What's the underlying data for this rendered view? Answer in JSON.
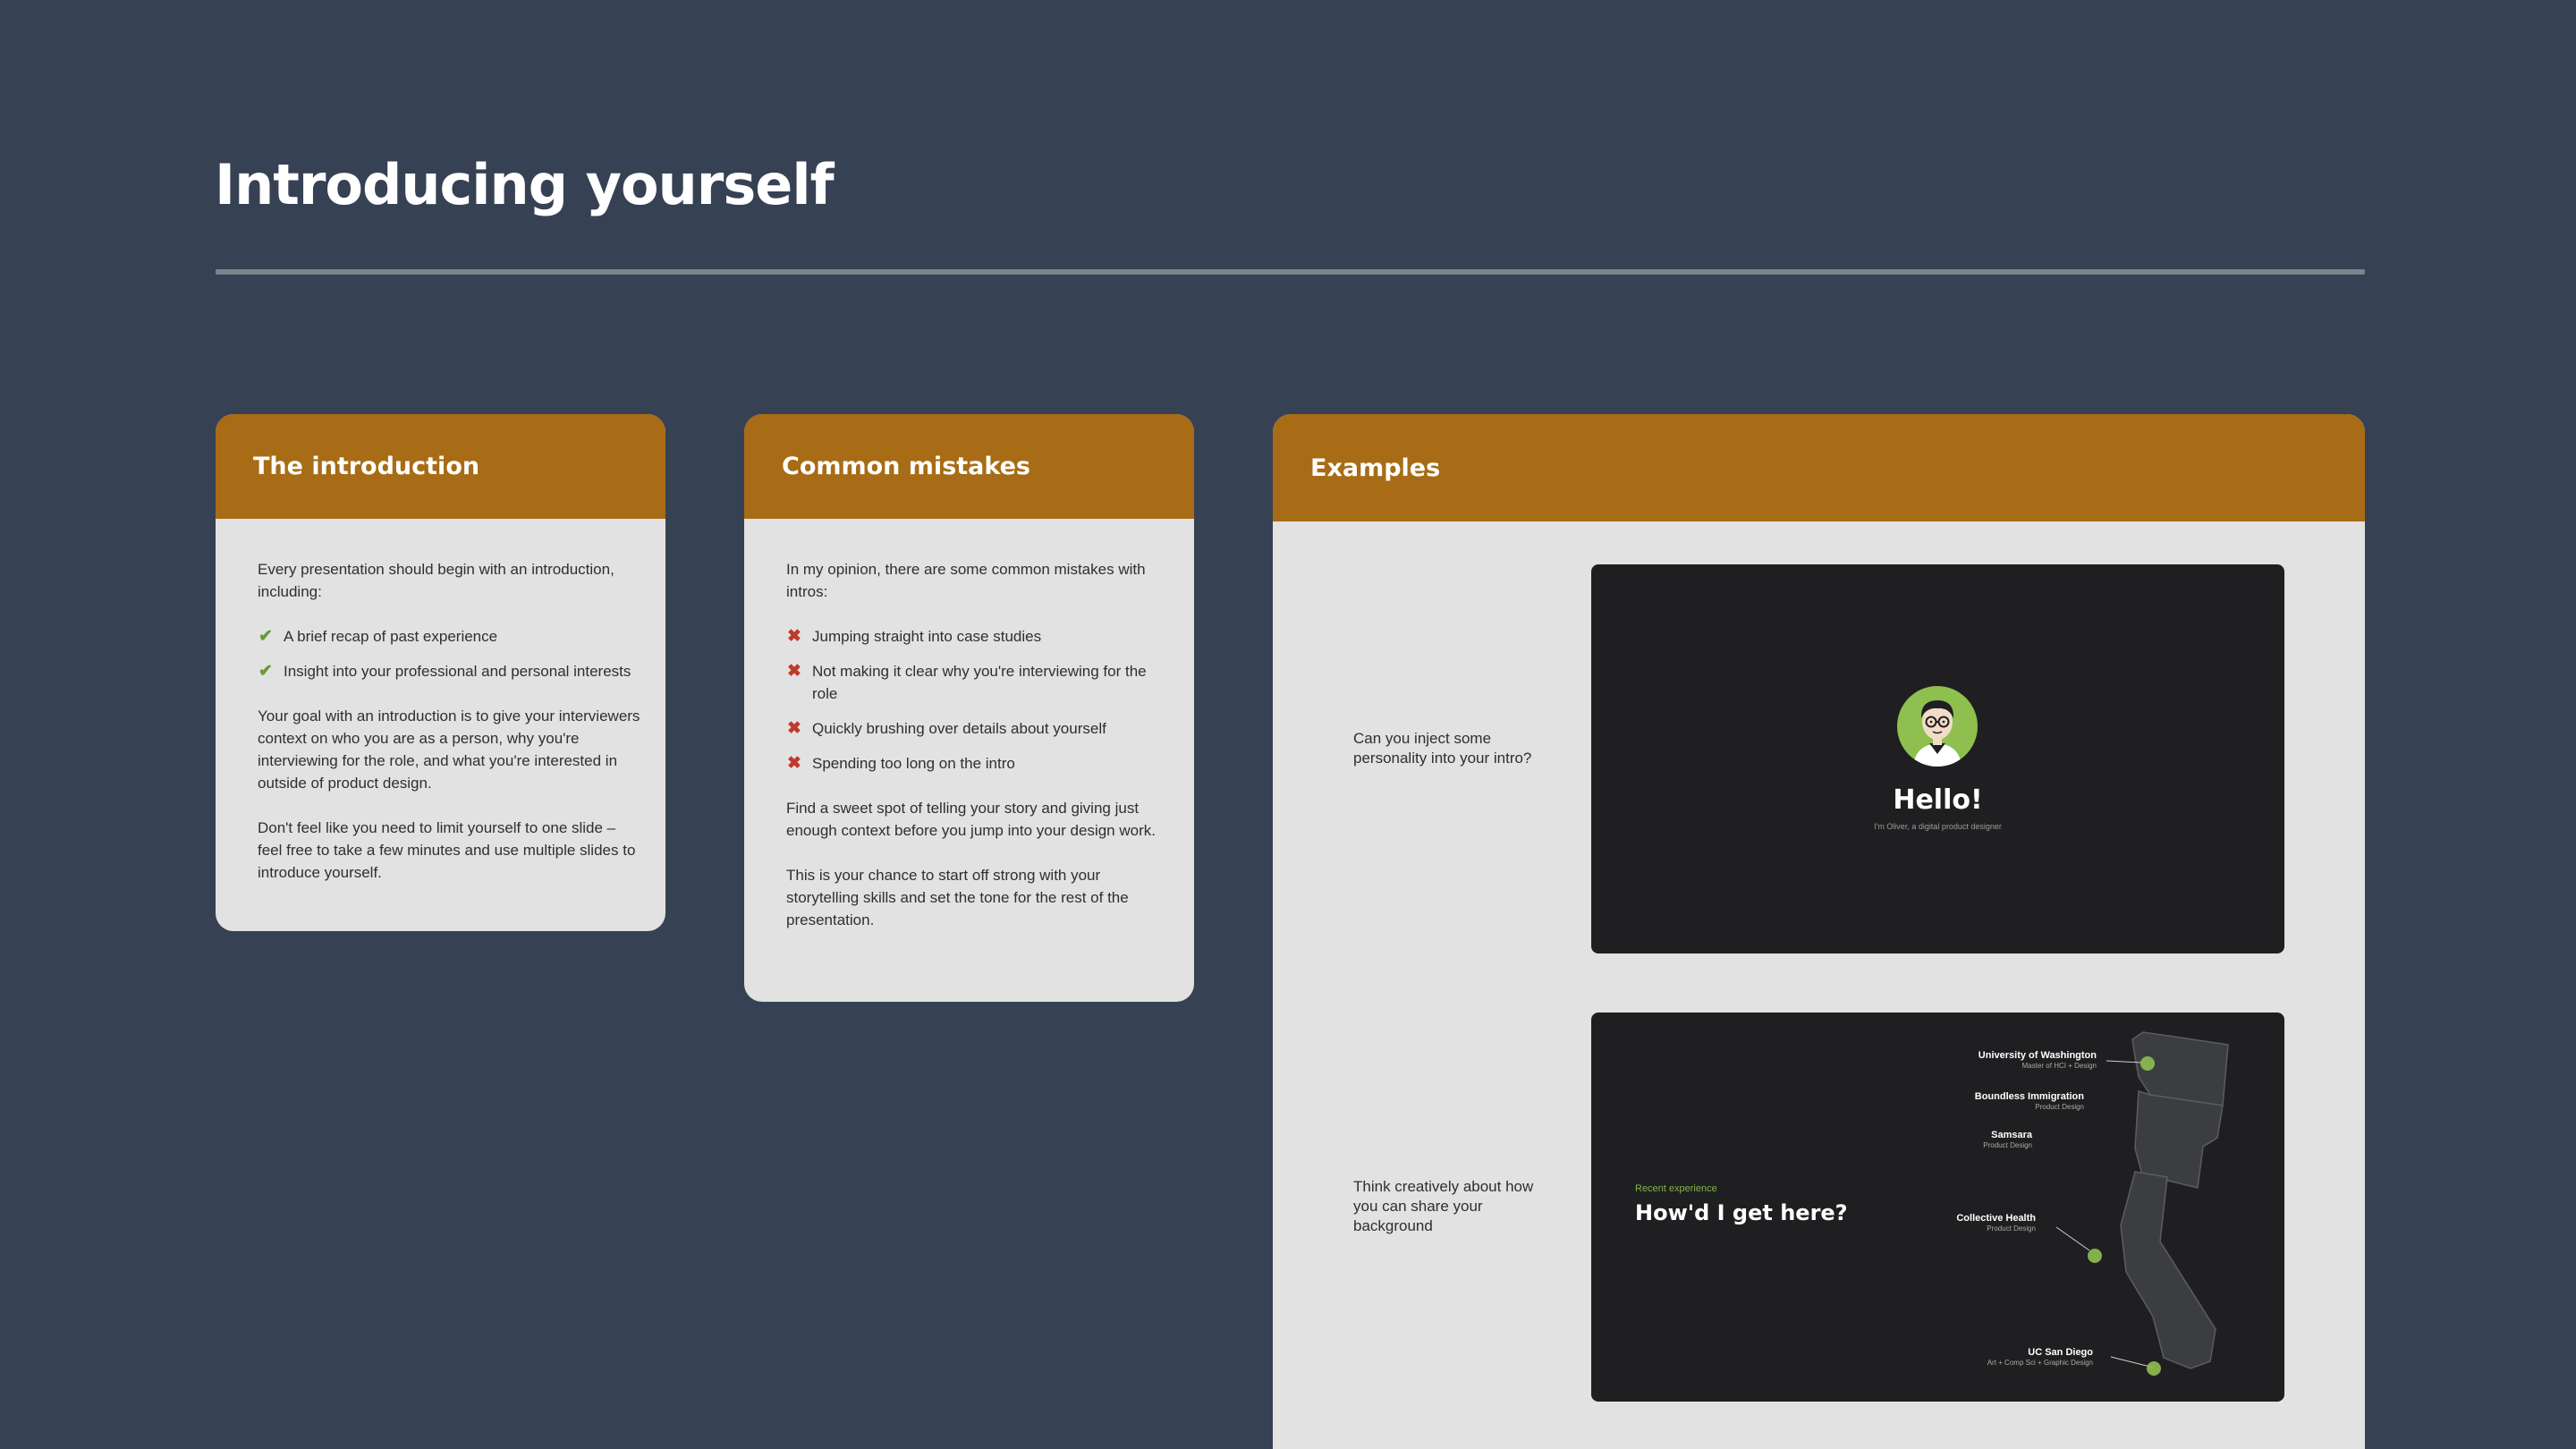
{
  "page": {
    "title": "Introducing yourself"
  },
  "cards": {
    "introduction": {
      "title": "The introduction",
      "intro": "Every presentation should begin with an introduction, including:",
      "items": [
        "A brief recap of past experience",
        "Insight into your professional and personal interests"
      ],
      "paragraphs": [
        "Your goal with an introduction is to give your interviewers context on who you are as a person, why you're interviewing for the role, and what you're interested in outside of product design.",
        "Don't feel like you need to limit yourself to one slide – feel free to take a few minutes and use multiple slides to introduce yourself."
      ]
    },
    "mistakes": {
      "title": "Common mistakes",
      "intro": "In my opinion, there are some common mistakes with intros:",
      "items": [
        "Jumping straight into case studies",
        "Not making it clear why you're interviewing for the role",
        "Quickly brushing over details about yourself",
        "Spending too long on the intro"
      ],
      "paragraphs": [
        "Find a sweet spot of telling your story and giving just enough context before you jump into your design work.",
        "This is your chance to start off strong with your storytelling skills and set the tone for the rest of the presentation."
      ]
    },
    "examples": {
      "title": "Examples",
      "example1": {
        "caption": "Can you inject some personality into your intro?",
        "hello": "Hello!",
        "subtitle": "I'm Oliver, a digital product designer"
      },
      "example2": {
        "caption": "Think creatively about how you can share your background",
        "eyebrow": "Recent experience",
        "heading": "How'd I get here?",
        "locations": [
          {
            "name": "University of Washington",
            "role": "Master of HCI + Design"
          },
          {
            "name": "Boundless Immigration",
            "role": "Product Design"
          },
          {
            "name": "Samsara",
            "role": "Product Design"
          },
          {
            "name": "Collective Health",
            "role": "Product Design"
          },
          {
            "name": "UC San Diego",
            "role": "Art + Comp Sci + Graphic Design"
          }
        ]
      }
    }
  },
  "icons": {
    "check": "check-icon",
    "cross": "x-icon",
    "avatar": "avatar-illustration"
  },
  "colors": {
    "background": "#374154",
    "accent": "#a76c15",
    "card": "#e2e2e2",
    "slide": "#1f1f21",
    "green": "#7fb64b"
  }
}
